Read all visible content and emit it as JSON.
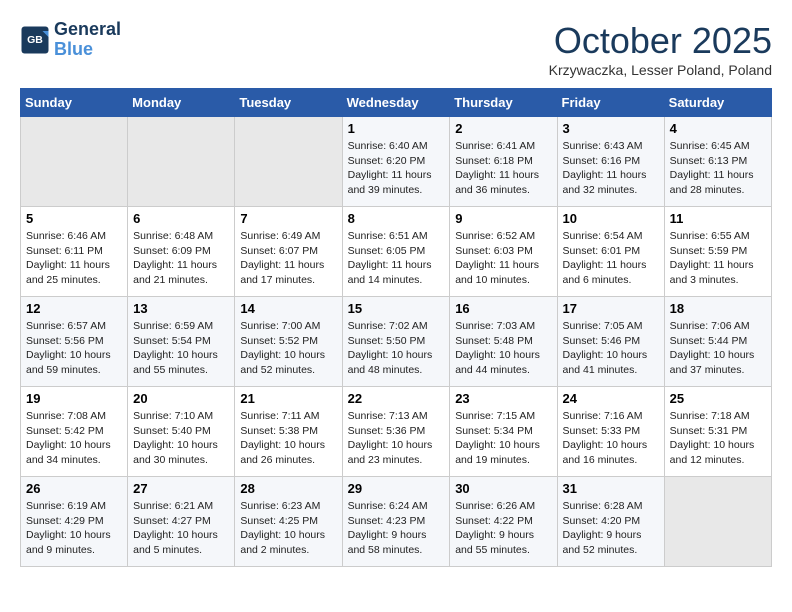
{
  "header": {
    "logo_line1": "General",
    "logo_line2": "Blue",
    "month": "October 2025",
    "location": "Krzywaczka, Lesser Poland, Poland"
  },
  "weekdays": [
    "Sunday",
    "Monday",
    "Tuesday",
    "Wednesday",
    "Thursday",
    "Friday",
    "Saturday"
  ],
  "weeks": [
    [
      {
        "day": "",
        "empty": true
      },
      {
        "day": "",
        "empty": true
      },
      {
        "day": "",
        "empty": true
      },
      {
        "day": "1",
        "lines": [
          "Sunrise: 6:40 AM",
          "Sunset: 6:20 PM",
          "Daylight: 11 hours",
          "and 39 minutes."
        ]
      },
      {
        "day": "2",
        "lines": [
          "Sunrise: 6:41 AM",
          "Sunset: 6:18 PM",
          "Daylight: 11 hours",
          "and 36 minutes."
        ]
      },
      {
        "day": "3",
        "lines": [
          "Sunrise: 6:43 AM",
          "Sunset: 6:16 PM",
          "Daylight: 11 hours",
          "and 32 minutes."
        ]
      },
      {
        "day": "4",
        "lines": [
          "Sunrise: 6:45 AM",
          "Sunset: 6:13 PM",
          "Daylight: 11 hours",
          "and 28 minutes."
        ]
      }
    ],
    [
      {
        "day": "5",
        "lines": [
          "Sunrise: 6:46 AM",
          "Sunset: 6:11 PM",
          "Daylight: 11 hours",
          "and 25 minutes."
        ]
      },
      {
        "day": "6",
        "lines": [
          "Sunrise: 6:48 AM",
          "Sunset: 6:09 PM",
          "Daylight: 11 hours",
          "and 21 minutes."
        ]
      },
      {
        "day": "7",
        "lines": [
          "Sunrise: 6:49 AM",
          "Sunset: 6:07 PM",
          "Daylight: 11 hours",
          "and 17 minutes."
        ]
      },
      {
        "day": "8",
        "lines": [
          "Sunrise: 6:51 AM",
          "Sunset: 6:05 PM",
          "Daylight: 11 hours",
          "and 14 minutes."
        ]
      },
      {
        "day": "9",
        "lines": [
          "Sunrise: 6:52 AM",
          "Sunset: 6:03 PM",
          "Daylight: 11 hours",
          "and 10 minutes."
        ]
      },
      {
        "day": "10",
        "lines": [
          "Sunrise: 6:54 AM",
          "Sunset: 6:01 PM",
          "Daylight: 11 hours",
          "and 6 minutes."
        ]
      },
      {
        "day": "11",
        "lines": [
          "Sunrise: 6:55 AM",
          "Sunset: 5:59 PM",
          "Daylight: 11 hours",
          "and 3 minutes."
        ]
      }
    ],
    [
      {
        "day": "12",
        "lines": [
          "Sunrise: 6:57 AM",
          "Sunset: 5:56 PM",
          "Daylight: 10 hours",
          "and 59 minutes."
        ]
      },
      {
        "day": "13",
        "lines": [
          "Sunrise: 6:59 AM",
          "Sunset: 5:54 PM",
          "Daylight: 10 hours",
          "and 55 minutes."
        ]
      },
      {
        "day": "14",
        "lines": [
          "Sunrise: 7:00 AM",
          "Sunset: 5:52 PM",
          "Daylight: 10 hours",
          "and 52 minutes."
        ]
      },
      {
        "day": "15",
        "lines": [
          "Sunrise: 7:02 AM",
          "Sunset: 5:50 PM",
          "Daylight: 10 hours",
          "and 48 minutes."
        ]
      },
      {
        "day": "16",
        "lines": [
          "Sunrise: 7:03 AM",
          "Sunset: 5:48 PM",
          "Daylight: 10 hours",
          "and 44 minutes."
        ]
      },
      {
        "day": "17",
        "lines": [
          "Sunrise: 7:05 AM",
          "Sunset: 5:46 PM",
          "Daylight: 10 hours",
          "and 41 minutes."
        ]
      },
      {
        "day": "18",
        "lines": [
          "Sunrise: 7:06 AM",
          "Sunset: 5:44 PM",
          "Daylight: 10 hours",
          "and 37 minutes."
        ]
      }
    ],
    [
      {
        "day": "19",
        "lines": [
          "Sunrise: 7:08 AM",
          "Sunset: 5:42 PM",
          "Daylight: 10 hours",
          "and 34 minutes."
        ]
      },
      {
        "day": "20",
        "lines": [
          "Sunrise: 7:10 AM",
          "Sunset: 5:40 PM",
          "Daylight: 10 hours",
          "and 30 minutes."
        ]
      },
      {
        "day": "21",
        "lines": [
          "Sunrise: 7:11 AM",
          "Sunset: 5:38 PM",
          "Daylight: 10 hours",
          "and 26 minutes."
        ]
      },
      {
        "day": "22",
        "lines": [
          "Sunrise: 7:13 AM",
          "Sunset: 5:36 PM",
          "Daylight: 10 hours",
          "and 23 minutes."
        ]
      },
      {
        "day": "23",
        "lines": [
          "Sunrise: 7:15 AM",
          "Sunset: 5:34 PM",
          "Daylight: 10 hours",
          "and 19 minutes."
        ]
      },
      {
        "day": "24",
        "lines": [
          "Sunrise: 7:16 AM",
          "Sunset: 5:33 PM",
          "Daylight: 10 hours",
          "and 16 minutes."
        ]
      },
      {
        "day": "25",
        "lines": [
          "Sunrise: 7:18 AM",
          "Sunset: 5:31 PM",
          "Daylight: 10 hours",
          "and 12 minutes."
        ]
      }
    ],
    [
      {
        "day": "26",
        "lines": [
          "Sunrise: 6:19 AM",
          "Sunset: 4:29 PM",
          "Daylight: 10 hours",
          "and 9 minutes."
        ]
      },
      {
        "day": "27",
        "lines": [
          "Sunrise: 6:21 AM",
          "Sunset: 4:27 PM",
          "Daylight: 10 hours",
          "and 5 minutes."
        ]
      },
      {
        "day": "28",
        "lines": [
          "Sunrise: 6:23 AM",
          "Sunset: 4:25 PM",
          "Daylight: 10 hours",
          "and 2 minutes."
        ]
      },
      {
        "day": "29",
        "lines": [
          "Sunrise: 6:24 AM",
          "Sunset: 4:23 PM",
          "Daylight: 9 hours",
          "and 58 minutes."
        ]
      },
      {
        "day": "30",
        "lines": [
          "Sunrise: 6:26 AM",
          "Sunset: 4:22 PM",
          "Daylight: 9 hours",
          "and 55 minutes."
        ]
      },
      {
        "day": "31",
        "lines": [
          "Sunrise: 6:28 AM",
          "Sunset: 4:20 PM",
          "Daylight: 9 hours",
          "and 52 minutes."
        ]
      },
      {
        "day": "",
        "empty": true
      }
    ]
  ]
}
